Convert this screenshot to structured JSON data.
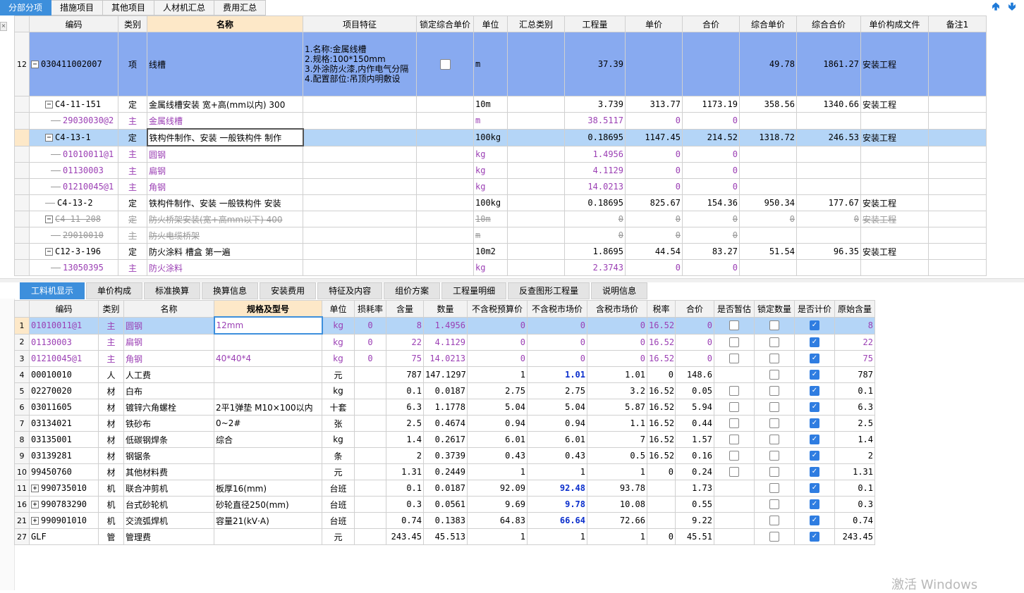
{
  "top_tabs": [
    {
      "label": "分部分项",
      "active": true
    },
    {
      "label": "措施项目",
      "active": false
    },
    {
      "label": "其他项目",
      "active": false
    },
    {
      "label": "人材机汇总",
      "active": false
    },
    {
      "label": "费用汇总",
      "active": false
    }
  ],
  "upper": {
    "headers": [
      "编码",
      "类别",
      "名称",
      "项目特征",
      "锁定综合单价",
      "单位",
      "汇总类别",
      "工程量",
      "单价",
      "合价",
      "综合单价",
      "综合合价",
      "单价构成文件",
      "备注1"
    ],
    "main_row": {
      "rownum": "12",
      "code": "030411002007",
      "type": "项",
      "name": "线槽",
      "feature_lines": [
        "1.名称:金属线槽",
        "2.规格:100*150mm",
        "3.外涂防火漆,内作电气分隔",
        "4.配置部位:吊顶内明敷设"
      ],
      "unit": "m",
      "qty": "37.39",
      "zhdj": "49.78",
      "zhhj": "1861.27",
      "file": "安装工程"
    },
    "rows": [
      {
        "code": "C4-11-151",
        "type": "定",
        "name": "金属线槽安装 宽+高(mm以内) 300",
        "unit": "10m",
        "qty": "3.739",
        "dj": "313.77",
        "hj": "1173.19",
        "zhdj": "358.56",
        "zhhj": "1340.66",
        "file": "安装工程",
        "level": 1,
        "tree": "−",
        "style": ""
      },
      {
        "code": "29030030@2",
        "type": "主",
        "name": "金属线槽",
        "unit": "m",
        "qty": "38.5117",
        "dj": "0",
        "hj": "0",
        "zhdj": "",
        "zhhj": "",
        "file": "",
        "level": 2,
        "tree": "",
        "style": "purple"
      },
      {
        "code": "C4-13-1",
        "type": "定",
        "name": "铁构件制作、安装 一般铁构件 制作",
        "unit": "100kg",
        "qty": "0.18695",
        "dj": "1147.45",
        "hj": "214.52",
        "zhdj": "1318.72",
        "zhhj": "246.53",
        "file": "安装工程",
        "level": 1,
        "tree": "−",
        "style": "selected"
      },
      {
        "code": "01010011@1",
        "type": "主",
        "name": "圆钢",
        "unit": "kg",
        "qty": "1.4956",
        "dj": "0",
        "hj": "0",
        "zhdj": "",
        "zhhj": "",
        "file": "",
        "level": 2,
        "tree": "",
        "style": "purple"
      },
      {
        "code": "01130003",
        "type": "主",
        "name": "扁钢",
        "unit": "kg",
        "qty": "4.1129",
        "dj": "0",
        "hj": "0",
        "zhdj": "",
        "zhhj": "",
        "file": "",
        "level": 2,
        "tree": "",
        "style": "purple"
      },
      {
        "code": "01210045@1",
        "type": "主",
        "name": "角钢",
        "unit": "kg",
        "qty": "14.0213",
        "dj": "0",
        "hj": "0",
        "zhdj": "",
        "zhhj": "",
        "file": "",
        "level": 2,
        "tree": "",
        "style": "purple"
      },
      {
        "code": "C4-13-2",
        "type": "定",
        "name": "铁构件制作、安装 一般铁构件 安装",
        "unit": "100kg",
        "qty": "0.18695",
        "dj": "825.67",
        "hj": "154.36",
        "zhdj": "950.34",
        "zhhj": "177.67",
        "file": "安装工程",
        "level": 1,
        "tree": "",
        "style": ""
      },
      {
        "code": "C4-11-208",
        "type": "定",
        "name": "防火桥架安装(宽+高mm以下) 400",
        "unit": "10m",
        "qty": "0",
        "dj": "0",
        "hj": "0",
        "zhdj": "0",
        "zhhj": "0",
        "file": "安装工程",
        "level": 1,
        "tree": "−",
        "style": "strike"
      },
      {
        "code": "29010010",
        "type": "主",
        "name": "防火电缆桥架",
        "unit": "m",
        "qty": "0",
        "dj": "0",
        "hj": "0",
        "zhdj": "",
        "zhhj": "",
        "file": "",
        "level": 2,
        "tree": "",
        "style": "strike"
      },
      {
        "code": "C12-3-196",
        "type": "定",
        "name": "防火涂料 槽盒 第一遍",
        "unit": "10m2",
        "qty": "1.8695",
        "dj": "44.54",
        "hj": "83.27",
        "zhdj": "51.54",
        "zhhj": "96.35",
        "file": "安装工程",
        "level": 1,
        "tree": "−",
        "style": ""
      },
      {
        "code": "13050395",
        "type": "主",
        "name": "防火涂料",
        "unit": "kg",
        "qty": "2.3743",
        "dj": "0",
        "hj": "0",
        "zhdj": "",
        "zhhj": "",
        "file": "",
        "level": 2,
        "tree": "",
        "style": "purple"
      }
    ]
  },
  "bottom_tabs": [
    {
      "label": "工料机显示",
      "active": true
    },
    {
      "label": "单价构成",
      "active": false
    },
    {
      "label": "标准换算",
      "active": false
    },
    {
      "label": "换算信息",
      "active": false
    },
    {
      "label": "安装费用",
      "active": false
    },
    {
      "label": "特征及内容",
      "active": false
    },
    {
      "label": "组价方案",
      "active": false
    },
    {
      "label": "工程量明细",
      "active": false
    },
    {
      "label": "反查图形工程量",
      "active": false
    },
    {
      "label": "说明信息",
      "active": false
    }
  ],
  "lower": {
    "headers": [
      "编码",
      "类别",
      "名称",
      "规格及型号",
      "单位",
      "损耗率",
      "含量",
      "数量",
      "不含税预算价",
      "不含税市场价",
      "含税市场价",
      "税率",
      "合价",
      "是否暂估",
      "锁定数量",
      "是否计价",
      "原始含量"
    ],
    "rows": [
      {
        "n": "1",
        "code": "01010011@1",
        "type": "主",
        "name": "圆钢",
        "spec": "12mm",
        "unit": "kg",
        "loss": "0",
        "hl": "8",
        "qty": "1.4956",
        "bhsys": "0",
        "bhssc": "0",
        "hssc": "0",
        "sl": "16.52",
        "hj": "0",
        "zg": "off",
        "sd": "off",
        "jj": "on",
        "yshl": "8",
        "purple": true,
        "bold": false,
        "plus": false
      },
      {
        "n": "2",
        "code": "01130003",
        "type": "主",
        "name": "扁钢",
        "spec": "",
        "unit": "kg",
        "loss": "0",
        "hl": "22",
        "qty": "4.1129",
        "bhsys": "0",
        "bhssc": "0",
        "hssc": "0",
        "sl": "16.52",
        "hj": "0",
        "zg": "off",
        "sd": "off",
        "jj": "on",
        "yshl": "22",
        "purple": true,
        "bold": false,
        "plus": false
      },
      {
        "n": "3",
        "code": "01210045@1",
        "type": "主",
        "name": "角钢",
        "spec": "40*40*4",
        "unit": "kg",
        "loss": "0",
        "hl": "75",
        "qty": "14.0213",
        "bhsys": "0",
        "bhssc": "0",
        "hssc": "0",
        "sl": "16.52",
        "hj": "0",
        "zg": "off",
        "sd": "off",
        "jj": "on",
        "yshl": "75",
        "purple": true,
        "bold": false,
        "plus": false
      },
      {
        "n": "4",
        "code": "00010010",
        "type": "人",
        "name": "人工费",
        "spec": "",
        "unit": "元",
        "loss": "",
        "hl": "787",
        "qty": "147.1297",
        "bhsys": "1",
        "bhssc": "1.01",
        "hssc": "1.01",
        "sl": "0",
        "hj": "148.6",
        "zg": "none",
        "sd": "off",
        "jj": "on",
        "yshl": "787",
        "purple": false,
        "bold": true,
        "plus": false
      },
      {
        "n": "5",
        "code": "02270020",
        "type": "材",
        "name": "白布",
        "spec": "",
        "unit": "kg",
        "loss": "",
        "hl": "0.1",
        "qty": "0.0187",
        "bhsys": "2.75",
        "bhssc": "2.75",
        "hssc": "3.2",
        "sl": "16.52",
        "hj": "0.05",
        "zg": "off",
        "sd": "off",
        "jj": "on",
        "yshl": "0.1",
        "purple": false,
        "bold": false,
        "plus": false
      },
      {
        "n": "6",
        "code": "03011605",
        "type": "材",
        "name": "镀锌六角螺栓",
        "spec": "2平1弹垫 M10×100以内",
        "unit": "十套",
        "loss": "",
        "hl": "6.3",
        "qty": "1.1778",
        "bhsys": "5.04",
        "bhssc": "5.04",
        "hssc": "5.87",
        "sl": "16.52",
        "hj": "5.94",
        "zg": "off",
        "sd": "off",
        "jj": "on",
        "yshl": "6.3",
        "purple": false,
        "bold": false,
        "plus": false
      },
      {
        "n": "7",
        "code": "03134021",
        "type": "材",
        "name": "铁砂布",
        "spec": "0~2#",
        "unit": "张",
        "loss": "",
        "hl": "2.5",
        "qty": "0.4674",
        "bhsys": "0.94",
        "bhssc": "0.94",
        "hssc": "1.1",
        "sl": "16.52",
        "hj": "0.44",
        "zg": "off",
        "sd": "off",
        "jj": "on",
        "yshl": "2.5",
        "purple": false,
        "bold": false,
        "plus": false
      },
      {
        "n": "8",
        "code": "03135001",
        "type": "材",
        "name": "低碳钢焊条",
        "spec": "综合",
        "unit": "kg",
        "loss": "",
        "hl": "1.4",
        "qty": "0.2617",
        "bhsys": "6.01",
        "bhssc": "6.01",
        "hssc": "7",
        "sl": "16.52",
        "hj": "1.57",
        "zg": "off",
        "sd": "off",
        "jj": "on",
        "yshl": "1.4",
        "purple": false,
        "bold": false,
        "plus": false
      },
      {
        "n": "9",
        "code": "03139281",
        "type": "材",
        "name": "钢锯条",
        "spec": "",
        "unit": "条",
        "loss": "",
        "hl": "2",
        "qty": "0.3739",
        "bhsys": "0.43",
        "bhssc": "0.43",
        "hssc": "0.5",
        "sl": "16.52",
        "hj": "0.16",
        "zg": "off",
        "sd": "off",
        "jj": "on",
        "yshl": "2",
        "purple": false,
        "bold": false,
        "plus": false
      },
      {
        "n": "10",
        "code": "99450760",
        "type": "材",
        "name": "其他材料费",
        "spec": "",
        "unit": "元",
        "loss": "",
        "hl": "1.31",
        "qty": "0.2449",
        "bhsys": "1",
        "bhssc": "1",
        "hssc": "1",
        "sl": "0",
        "hj": "0.24",
        "zg": "off",
        "sd": "off",
        "jj": "on",
        "yshl": "1.31",
        "purple": false,
        "bold": false,
        "plus": false
      },
      {
        "n": "11",
        "code": "990735010",
        "type": "机",
        "name": "联合冲剪机",
        "spec": "板厚16(mm)",
        "unit": "台班",
        "loss": "",
        "hl": "0.1",
        "qty": "0.0187",
        "bhsys": "92.09",
        "bhssc": "92.48",
        "hssc": "93.78",
        "sl": "",
        "hj": "1.73",
        "zg": "none",
        "sd": "off",
        "jj": "on",
        "yshl": "0.1",
        "purple": false,
        "bold": true,
        "plus": true
      },
      {
        "n": "16",
        "code": "990783290",
        "type": "机",
        "name": "台式砂轮机",
        "spec": "砂轮直径250(mm)",
        "unit": "台班",
        "loss": "",
        "hl": "0.3",
        "qty": "0.0561",
        "bhsys": "9.69",
        "bhssc": "9.78",
        "hssc": "10.08",
        "sl": "",
        "hj": "0.55",
        "zg": "none",
        "sd": "off",
        "jj": "on",
        "yshl": "0.3",
        "purple": false,
        "bold": true,
        "plus": true
      },
      {
        "n": "21",
        "code": "990901010",
        "type": "机",
        "name": "交流弧焊机",
        "spec": "容量21(kV·A)",
        "unit": "台班",
        "loss": "",
        "hl": "0.74",
        "qty": "0.1383",
        "bhsys": "64.83",
        "bhssc": "66.64",
        "hssc": "72.66",
        "sl": "",
        "hj": "9.22",
        "zg": "none",
        "sd": "off",
        "jj": "on",
        "yshl": "0.74",
        "purple": false,
        "bold": true,
        "plus": true
      },
      {
        "n": "27",
        "code": "GLF",
        "type": "管",
        "name": "管理费",
        "spec": "",
        "unit": "元",
        "loss": "",
        "hl": "243.45",
        "qty": "45.513",
        "bhsys": "1",
        "bhssc": "1",
        "hssc": "1",
        "sl": "0",
        "hj": "45.51",
        "zg": "none",
        "sd": "off",
        "jj": "on",
        "yshl": "243.45",
        "purple": false,
        "bold": false,
        "plus": false
      }
    ]
  },
  "watermark": "激活 Windows",
  "colors": {
    "accent": "#3d8fdc",
    "row_blue": "#88aaf0",
    "row_selected": "#b4d5f7",
    "purple": "#9b3fb4",
    "bold_blue": "#0a2ecc"
  }
}
